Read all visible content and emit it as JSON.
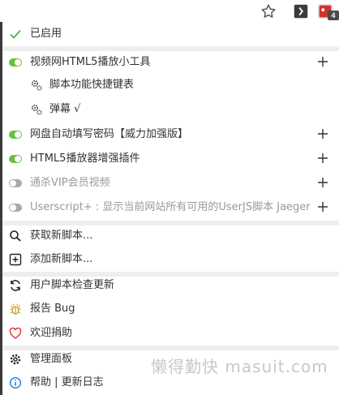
{
  "toolbar": {
    "star_icon": "star-outline-icon",
    "extension_icon": "script-extension-icon",
    "tampermonkey_icon": "tampermonkey-icon",
    "badge_count": "4",
    "accent": "#d32f2f"
  },
  "menu": {
    "enabled_label": "已启用",
    "scripts": [
      {
        "name": "视频网HTML5播放小工具",
        "enabled": true
      },
      {
        "name": "脚本功能快捷键表"
      },
      {
        "name": "弹幕 √"
      },
      {
        "name": "网盘自动填写密码【威力加强版】",
        "enabled": true
      },
      {
        "name": "HTML5播放器增强插件",
        "enabled": true
      },
      {
        "name": "通杀VIP会员视频",
        "enabled": false
      },
      {
        "name": "Userscript+ : 显示当前网站所有可用的UserJS脚本 Jaeger",
        "enabled": false
      }
    ],
    "actions": {
      "get_new": "获取新脚本...",
      "add_new": "添加新脚本...",
      "check_updates": "用户脚本检查更新",
      "report_bug": "报告 Bug",
      "donate": "欢迎捐助",
      "dashboard": "管理面板",
      "help": "帮助 | 更新日志"
    }
  },
  "watermark": "懒得勤快 masuit.com",
  "colors": {
    "toggle_on": "#6bbf3d",
    "toggle_off": "#a9a9a9",
    "check": "#4caf50",
    "bug": "#c9a227",
    "heart": "#e53935",
    "info": "#1e88e5"
  }
}
